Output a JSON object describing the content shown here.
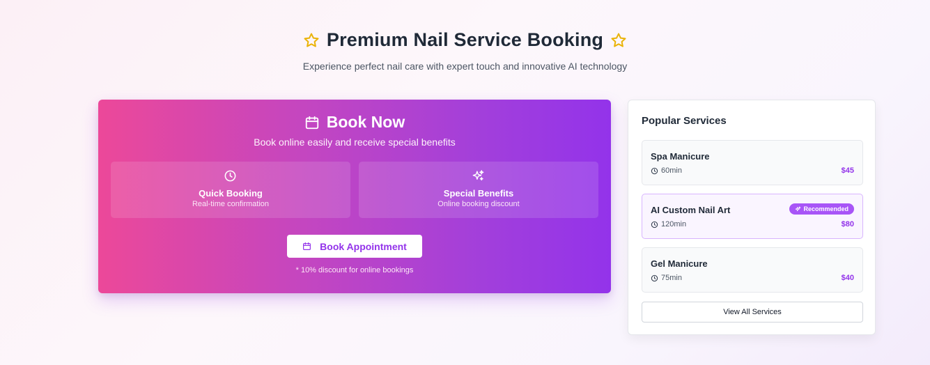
{
  "header": {
    "title": "Premium Nail Service Booking",
    "subtitle": "Experience perfect nail care with expert touch and innovative AI technology",
    "icons": [
      "star-icon",
      "star-icon"
    ],
    "star_color": "#eab308"
  },
  "booking": {
    "title": "Book Now",
    "subtitle": "Book online easily and receive special benefits",
    "features": [
      {
        "icon": "clock-icon",
        "name": "Quick Booking",
        "desc": "Real-time confirmation"
      },
      {
        "icon": "sparkles-icon",
        "name": "Special Benefits",
        "desc": "Online booking discount"
      }
    ],
    "button_label": "Book Appointment",
    "discount_note": "* 10% discount for online bookings",
    "gradient": [
      "#ec4899",
      "#9333ea"
    ]
  },
  "services": {
    "title": "Popular Services",
    "items": [
      {
        "name": "Spa Manicure",
        "duration": "60min",
        "price": "$45"
      },
      {
        "name": "AI Custom Nail Art",
        "duration": "120min",
        "price": "$80",
        "badge": "Recommended"
      },
      {
        "name": "Gel Manicure",
        "duration": "75min",
        "price": "$40"
      }
    ],
    "view_all_label": "View All Services",
    "accent": "#9333ea"
  }
}
